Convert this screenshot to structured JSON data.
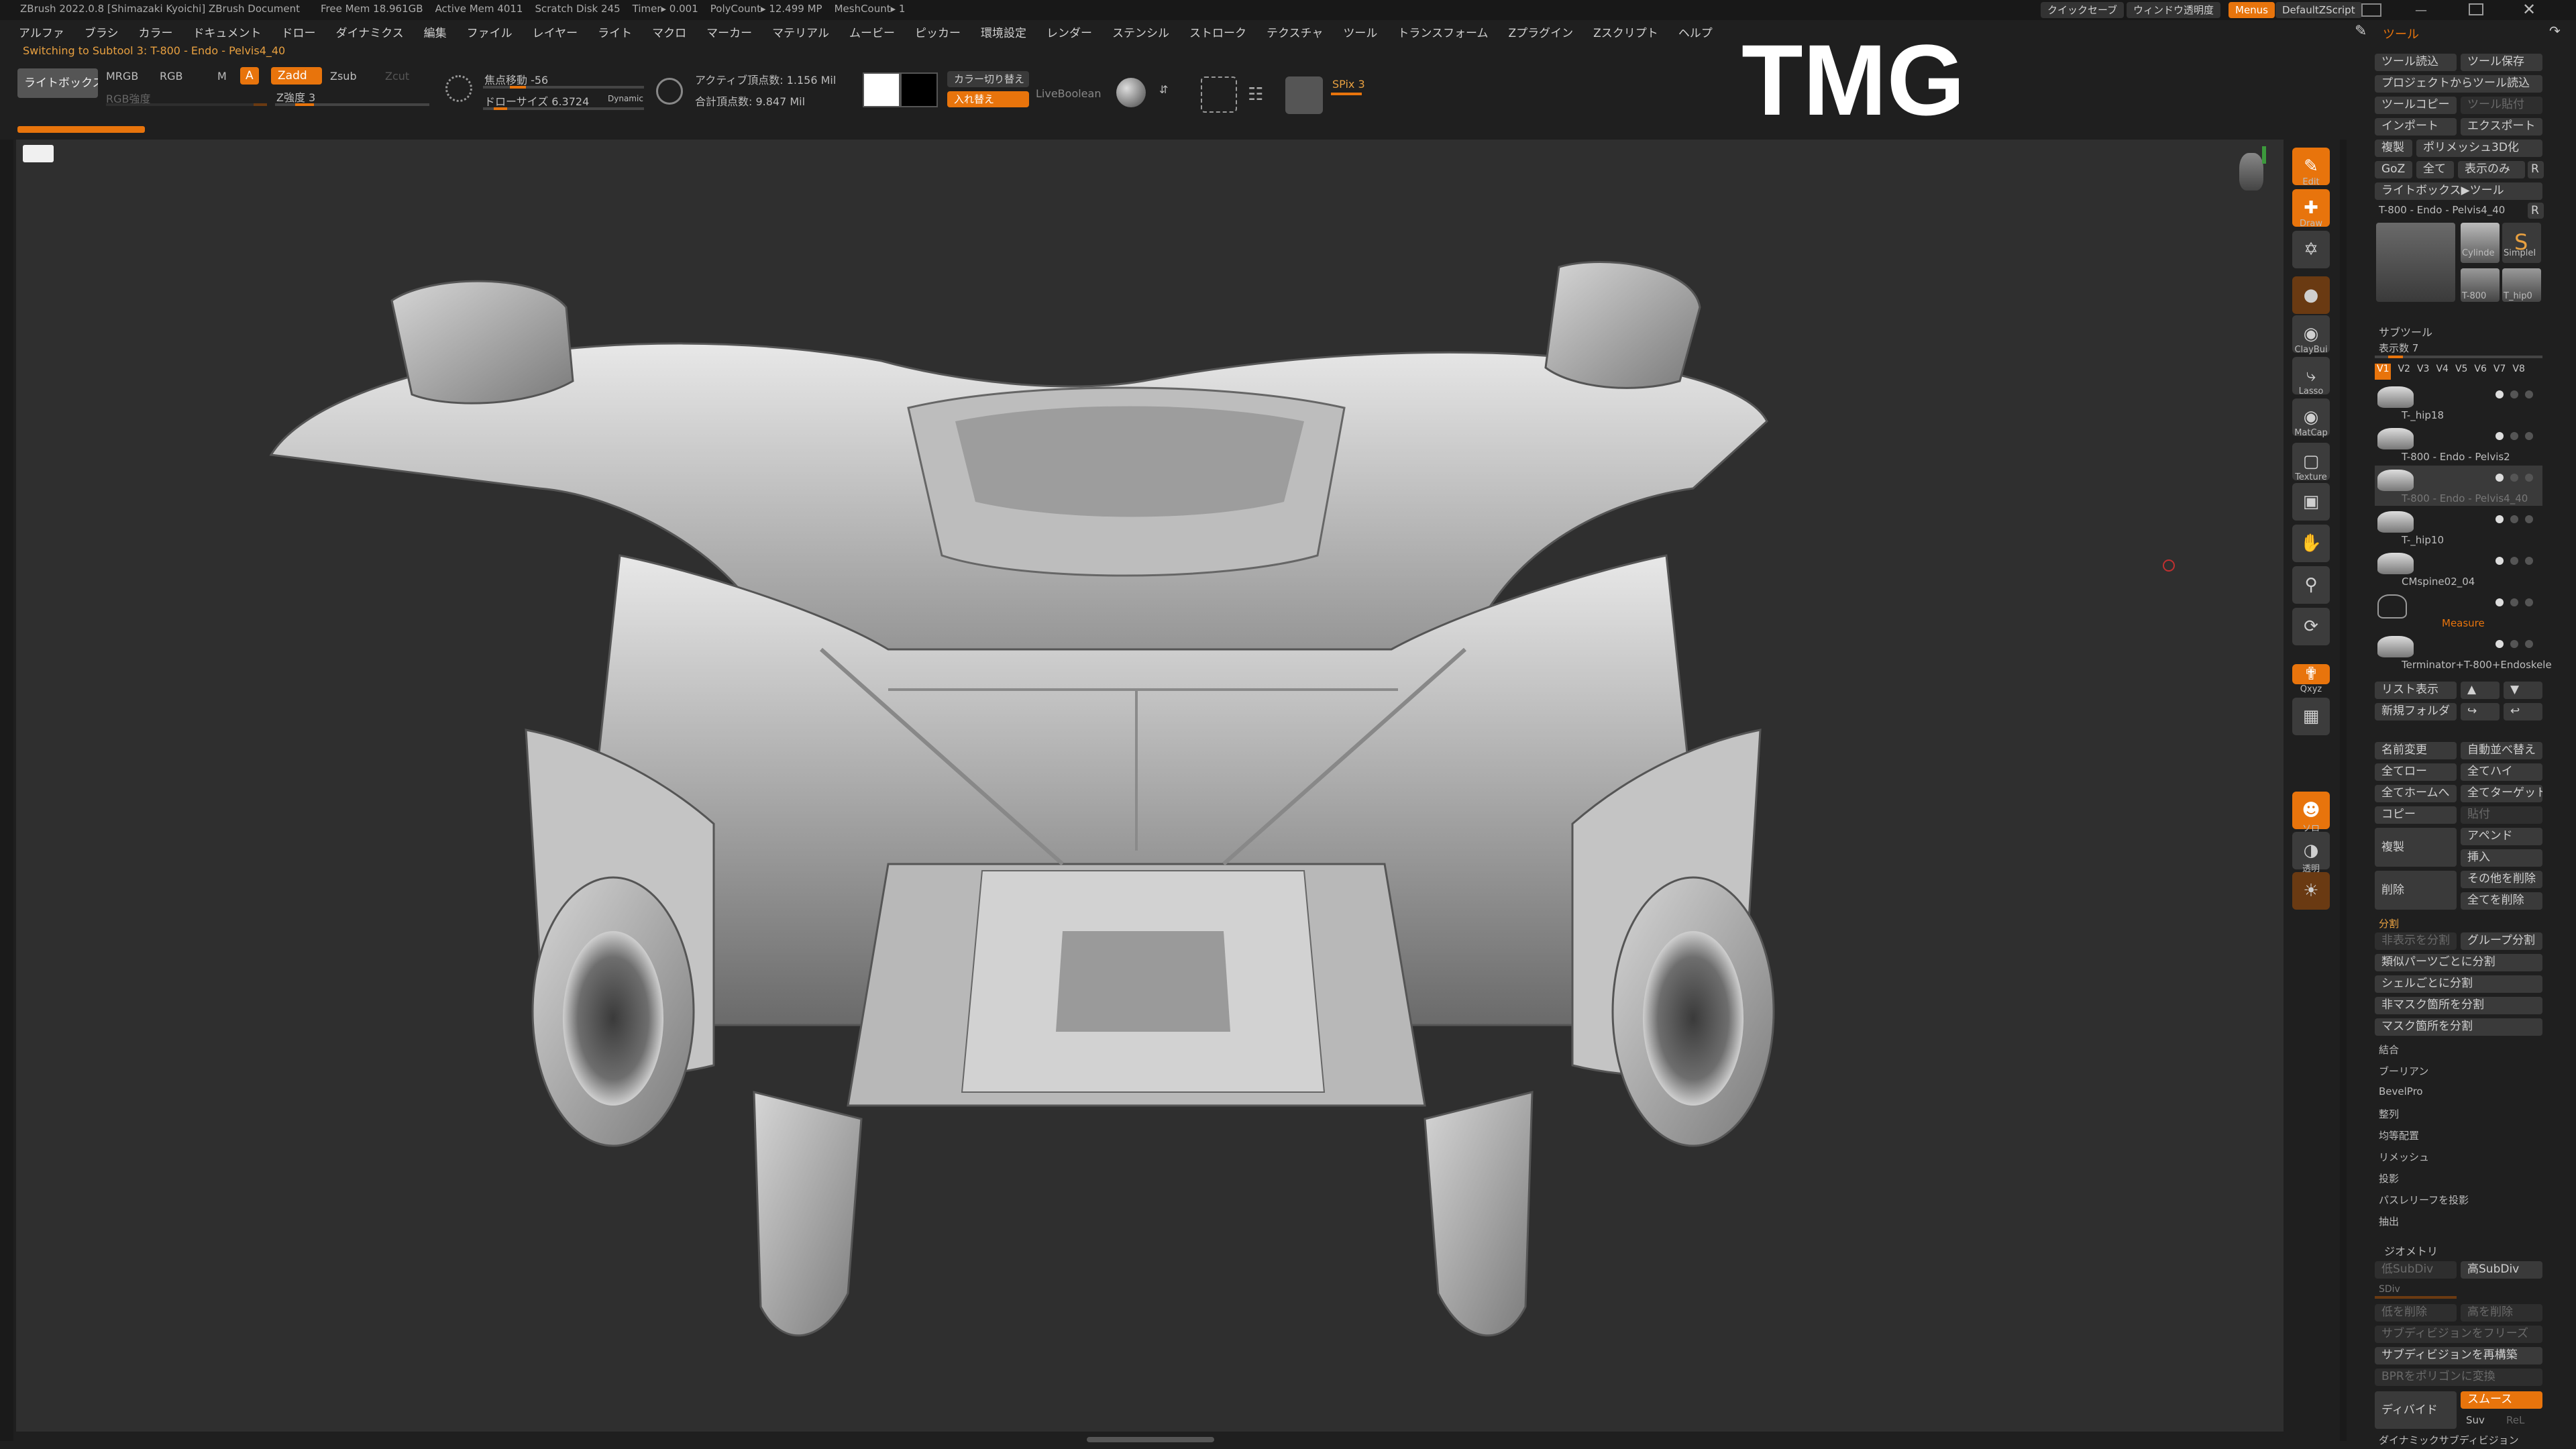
{
  "titlebar": {
    "title": "ZBrush 2022.0.8 [Shimazaki Kyoichi]   ZBrush Document",
    "stats": [
      "Free Mem 18.961GB",
      "Active Mem 4011",
      "Scratch Disk 245",
      "Timer▸ 0.001",
      "PolyCount▸ 12.499 MP",
      "MeshCount▸ 1"
    ],
    "quicksave": "クイックセーブ",
    "transparency": "ウィンドウ透明度",
    "menus_btn": "Menus",
    "zscript": "DefaultZScript"
  },
  "menubar": {
    "items": [
      "アルファ",
      "ブラシ",
      "カラー",
      "ドキュメント",
      "ドロー",
      "ダイナミクス",
      "編集",
      "ファイル",
      "レイヤー",
      "ライト",
      "マクロ",
      "マーカー",
      "マテリアル",
      "ムービー",
      "ピッカー",
      "環境設定",
      "レンダー",
      "ステンシル",
      "ストローク",
      "テクスチャ",
      "ツール",
      "トランスフォーム",
      "Zプラグイン",
      "Zスクリプト",
      "ヘルプ"
    ]
  },
  "status_line": "Switching to Subtool 3:  T-800 - Endo - Pelvis4_40",
  "toolbar": {
    "lightbox": "ライトボックス",
    "mrgb": "MRGB",
    "rgb": "RGB",
    "m": "M",
    "a": "A",
    "zadd": "Zadd",
    "zsub": "Zsub",
    "zcut": "Zcut",
    "rgb_intensity": "RGB強度",
    "z_intensity": "Z強度 3",
    "focal_shift": "焦点移動 -56",
    "draw_size": "ドローサイズ 6.3724",
    "dynamic": "Dynamic",
    "active_points": "アクティブ頂点数: 1.156 Mil",
    "total_points": "合計頂点数: 9.847 Mil",
    "color_switch": "カラー切り替え",
    "swap": "入れ替え",
    "live_boolean": "LiveBoolean",
    "spix": "SPix 3",
    "primary_color": "#ffffff",
    "secondary_color": "#000000",
    "accent": "#e8740c"
  },
  "watermark": "TMG",
  "canvas": {
    "model": "3d-pelvis-model",
    "background": "#2f2f2f"
  },
  "right_toolbar": [
    {
      "name": "edit-button",
      "label": "Edit",
      "icon": "edit-icon",
      "style": "orange"
    },
    {
      "name": "draw-button",
      "label": "Draw",
      "icon": "draw-icon",
      "style": "orange"
    },
    {
      "name": "move-button",
      "label": "",
      "icon": "move-icon",
      "style": "plain"
    },
    {
      "name": "material-slot",
      "label": "",
      "icon": "material-icon",
      "style": "dark"
    },
    {
      "name": "claybuildup-brush",
      "label": "ClayBui",
      "icon": "brush-icon",
      "style": "plain"
    },
    {
      "name": "lasso-stroke",
      "label": "Lasso",
      "icon": "lasso-icon",
      "style": "plain"
    },
    {
      "name": "matcap-material",
      "label": "MatCap",
      "icon": "sphere-icon",
      "style": "plain"
    },
    {
      "name": "texture-slot",
      "label": "Texture",
      "icon": "texture-icon",
      "style": "plain"
    },
    {
      "name": "frame-button",
      "label": "",
      "icon": "frame-icon",
      "style": "plain"
    },
    {
      "name": "move-view-button",
      "label": "",
      "icon": "hand-icon",
      "style": "plain"
    },
    {
      "name": "zoom-view-button",
      "label": "",
      "icon": "zoom-icon",
      "style": "plain"
    },
    {
      "name": "rotate-view-button",
      "label": "",
      "icon": "rotate-icon",
      "style": "plain"
    },
    {
      "name": "xyz-button",
      "label": "Qxyz",
      "icon": "xyz-icon",
      "style": "orange"
    },
    {
      "name": "polyframe-button",
      "label": "",
      "icon": "polyframe-icon",
      "style": "plain"
    },
    {
      "name": "solo-button",
      "label": "ソロ",
      "icon": "solo-icon",
      "style": "orange"
    },
    {
      "name": "transp-button",
      "label": "透明",
      "icon": "transparency-icon",
      "style": "plain"
    },
    {
      "name": "ghost-button",
      "label": "",
      "icon": "ghost-icon",
      "style": "dark"
    }
  ],
  "tool_panel": {
    "title": "ツール",
    "load": "ツール読込",
    "save": "ツール保存",
    "load_from_project": "プロジェクトからツール読込",
    "copy_tool": "ツールコピー",
    "paste_tool": "ツール貼付",
    "import": "インポート",
    "export": "エクスポート",
    "clone": "複製",
    "make_polymesh": "ポリメッシュ3D化",
    "goz": "GoZ",
    "all": "全て",
    "visible": "表示のみ",
    "r": "R",
    "lightbox_tools": "ライトボックス▶ツール",
    "current_tool": "T-800 - Endo - Pelvis4_40",
    "thumbs": [
      "Cylinde",
      "SimpleI",
      "T-800",
      "T_hip0"
    ]
  },
  "subtool": {
    "title": "サブツール",
    "visible_count": "表示数 7",
    "versions": [
      "V1",
      "V2",
      "V3",
      "V4",
      "V5",
      "V6",
      "V7",
      "V8"
    ],
    "items": [
      {
        "name": "T-_hip18"
      },
      {
        "name": "T-800 - Endo - Pelvis2"
      },
      {
        "name": "T-800 - Endo - Pelvis4_40"
      },
      {
        "name": "T-_hip10"
      },
      {
        "name": "CMspine02_04"
      },
      {
        "name": "Measure"
      },
      {
        "name": "Terminator+T-800+Endoskele"
      }
    ],
    "list_view": "リスト表示",
    "new_folder": "新規フォルダ",
    "rename": "名前変更",
    "auto_reorder": "自動並べ替え",
    "all_low": "全てロー",
    "all_high": "全てハイ",
    "all_home": "全てホームへ",
    "all_target": "全てターゲット",
    "copy": "コピー",
    "paste": "貼付",
    "duplicate": "複製",
    "append": "アペンド",
    "insert": "挿入",
    "delete": "削除",
    "delete_others": "その他を削除",
    "delete_all": "全てを削除",
    "split": "分割",
    "split_hidden": "非表示を分割",
    "group_split": "グループ分割",
    "split_similar": "類似パーツごとに分割",
    "split_shell": "シェルごとに分割",
    "split_unmasked": "非マスク箇所を分割",
    "split_masked": "マスク箇所を分割",
    "sections": [
      "結合",
      "ブーリアン",
      "BevelPro",
      "整列",
      "均等配置",
      "リメッシュ",
      "投影",
      "パスレリーフを投影",
      "抽出"
    ]
  },
  "geometry": {
    "title": "ジオメトリ",
    "lower_res": "低SubDiv",
    "higher_res": "高SubDiv",
    "subdiv_level": "SDiv",
    "delete_lower": "低を削除",
    "delete_higher": "高を削除",
    "freeze": "サブディビジョンをフリーズ",
    "reconstruct": "サブディビジョンを再構築",
    "convert": "BPRをポリゴンに変換",
    "divide": "ディバイド",
    "smooth": "スムース",
    "suv": "Suv",
    "rel": "ReL",
    "dynamic_subdiv": "ダイナミックサブディビジョン"
  }
}
